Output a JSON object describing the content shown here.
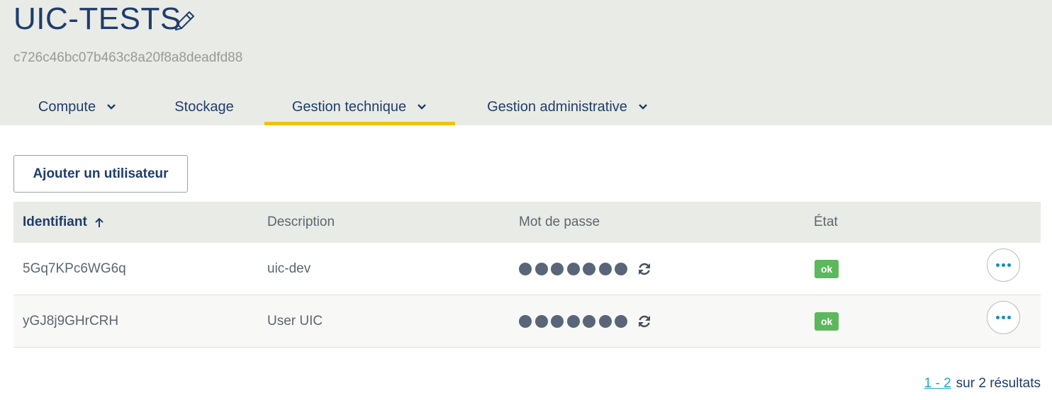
{
  "project": {
    "title": "UIC-TESTS",
    "id": "c726c46bc07b463c8a20f8a8deadfd88"
  },
  "tabs": [
    {
      "label": "Compute",
      "has_dropdown": true,
      "active": false
    },
    {
      "label": "Stockage",
      "has_dropdown": false,
      "active": false
    },
    {
      "label": "Gestion technique",
      "has_dropdown": true,
      "active": true
    },
    {
      "label": "Gestion administrative",
      "has_dropdown": true,
      "active": false
    }
  ],
  "add_user_label": "Ajouter un utilisateur",
  "table": {
    "columns": [
      "Identifiant",
      "Description",
      "Mot de passe",
      "État"
    ],
    "sort_column": "Identifiant",
    "sort_direction": "ascending",
    "rows": [
      {
        "id": "5Gq7KPc6WG6q",
        "description": "uic-dev",
        "status": "ok"
      },
      {
        "id": "yGJ8j9GHrCRH",
        "description": "User UIC",
        "status": "ok"
      }
    ]
  },
  "pagination": {
    "range": "1 - 2",
    "summary": "sur 2 résultats"
  },
  "colors": {
    "header_bg": "#e9ebe6",
    "title": "#1f3d6b",
    "active_tab_underline": "#f0c300",
    "status_ok": "#5cb85c",
    "link": "#18a8c7"
  },
  "icons": [
    "pencil-icon",
    "chevron-down-icon",
    "arrow-up-icon",
    "refresh-icon",
    "more-dots-icon"
  ]
}
